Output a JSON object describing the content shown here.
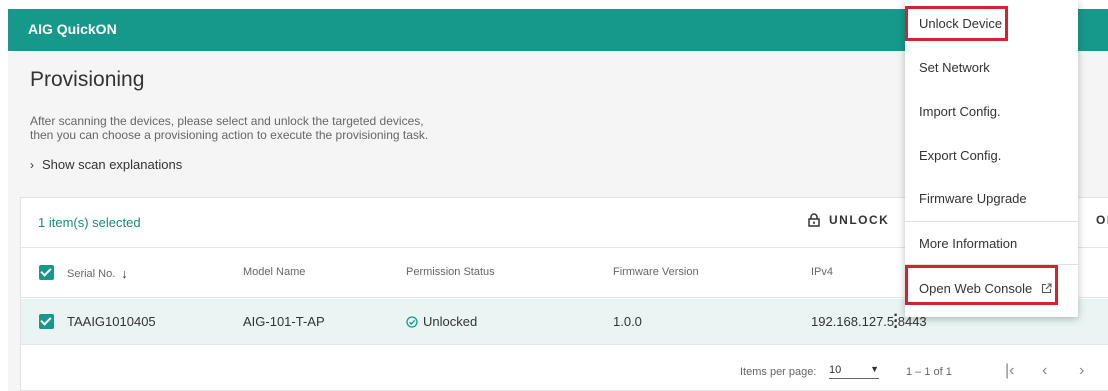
{
  "header": {
    "app_title": "AIG QuickON"
  },
  "page": {
    "title": "Provisioning",
    "description_line1": "After scanning the devices, please select and unlock the targeted devices,",
    "description_line2": "then you can choose a provisioning action to execute the provisioning task.",
    "scan_toggle_label": "Show scan explanations"
  },
  "toolbar": {
    "selected_count": "1 item(s) selected",
    "unlock_label": "UNLOCK",
    "action_label": "ON"
  },
  "table": {
    "columns": [
      "Serial No.",
      "Model Name",
      "Permission Status",
      "Firmware Version",
      "IPv4"
    ],
    "rows": [
      {
        "serial": "TAAIG1010405",
        "model": "AIG-101-T-AP",
        "status": "Unlocked",
        "firmware": "1.0.0",
        "ipv4": "192.168.127.5:8443",
        "selected": true
      }
    ]
  },
  "pagination": {
    "items_per_page_label": "Items per page:",
    "items_per_page_value": "10",
    "range": "1 – 1 of 1"
  },
  "context_menu": {
    "items": [
      "Unlock Device",
      "Set Network",
      "Import Config.",
      "Export Config.",
      "Firmware Upgrade",
      "More Information",
      "Open Web Console"
    ]
  },
  "colors": {
    "brand": "#16998b",
    "highlight": "#d8202f",
    "selected_row": "#e9f4f3"
  },
  "icons": [
    "lock-icon",
    "arrow-down-icon",
    "check-circle-icon",
    "kebab-icon",
    "external-link-icon",
    "chevron-right-icon",
    "first-page-icon",
    "prev-page-icon",
    "next-page-icon",
    "dropdown-caret-icon"
  ]
}
